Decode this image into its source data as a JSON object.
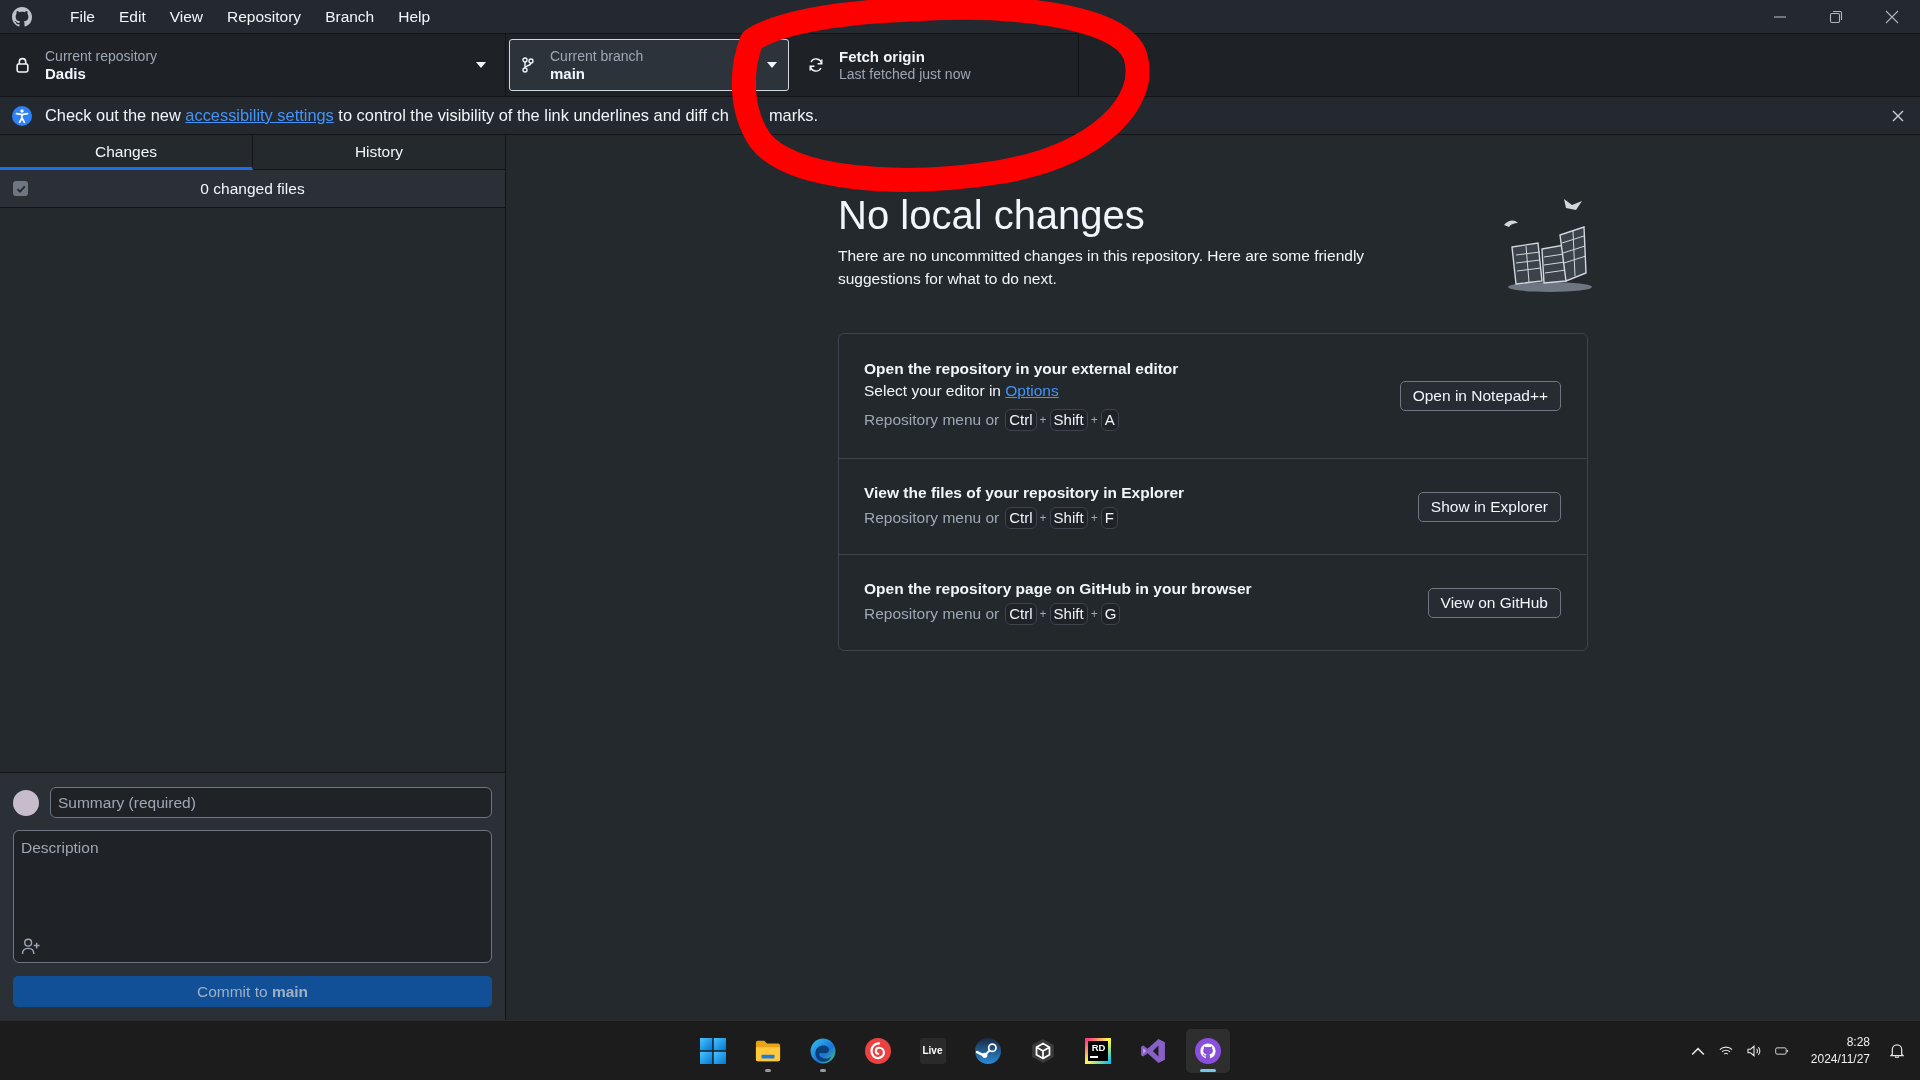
{
  "menu_bar": {
    "items": [
      "File",
      "Edit",
      "View",
      "Repository",
      "Branch",
      "Help"
    ]
  },
  "toolbar": {
    "repository": {
      "label": "Current repository",
      "value": "Dadis"
    },
    "branch": {
      "label": "Current branch",
      "value": "main",
      "focused": true
    },
    "fetch": {
      "title": "Fetch origin",
      "subtitle": "Last fetched just now"
    }
  },
  "banner": {
    "text_before": "Check out the new",
    "link": "accessibility settings",
    "text_after": "to control the visibility of the link underlines and diff ch",
    "text_tail": "marks."
  },
  "annotation": {
    "kind": "circle"
  },
  "sidebar": {
    "tabs": [
      {
        "label": "Changes",
        "selected": true
      },
      {
        "label": "History",
        "selected": false
      }
    ],
    "changes_header": {
      "label": "0 changed files",
      "checked": true,
      "disabled": true
    },
    "commit": {
      "summary": {
        "placeholder": "Summary (required)"
      },
      "description": {
        "placeholder": "Description"
      },
      "button": {
        "label": "Commit to **main**",
        "disabled": true
      }
    }
  },
  "main": {
    "title": "No local changes",
    "text": "There are no uncommitted changes in this repository. Here are some friendly suggestions for what to do next.",
    "actions": [
      {
        "title": "Open the repository in your external editor",
        "hint": "Select your editor in",
        "hint_link": "Options",
        "shortcut_prefix": "Repository menu or",
        "keys": [
          "Ctrl",
          "Shift",
          "A"
        ],
        "joiner": "+",
        "button": "Open in Notepad++"
      },
      {
        "title": "View the files of your repository in Explorer",
        "shortcut_prefix": "Repository menu or",
        "keys": [
          "Ctrl",
          "Shift",
          "F"
        ],
        "joiner": "+",
        "button": "Show in Explorer"
      },
      {
        "title": "Open the repository page on GitHub in your browser",
        "shortcut_prefix": "Repository menu or",
        "keys": [
          "Ctrl",
          "Shift",
          "G"
        ],
        "joiner": "+",
        "button": "View on GitHub"
      }
    ]
  },
  "taskbar": {
    "apps": [
      {
        "kind": "start",
        "running": false,
        "selected": false
      },
      {
        "kind": "folder",
        "running": true,
        "selected": false
      },
      {
        "kind": "browser",
        "running": true,
        "selected": false
      },
      {
        "kind": "music",
        "running": false,
        "selected": false
      },
      {
        "kind": "live",
        "label": "Live",
        "running": false,
        "selected": false
      },
      {
        "kind": "steam",
        "running": false,
        "selected": false
      },
      {
        "kind": "cube",
        "running": false,
        "selected": false
      },
      {
        "kind": "rider",
        "label": "RD",
        "running": false,
        "selected": false
      },
      {
        "kind": "studio",
        "running": false,
        "selected": false
      },
      {
        "kind": "github",
        "running": true,
        "selected": true
      }
    ],
    "tray": {
      "time": "8:28",
      "date": "2024/11/27"
    }
  }
}
